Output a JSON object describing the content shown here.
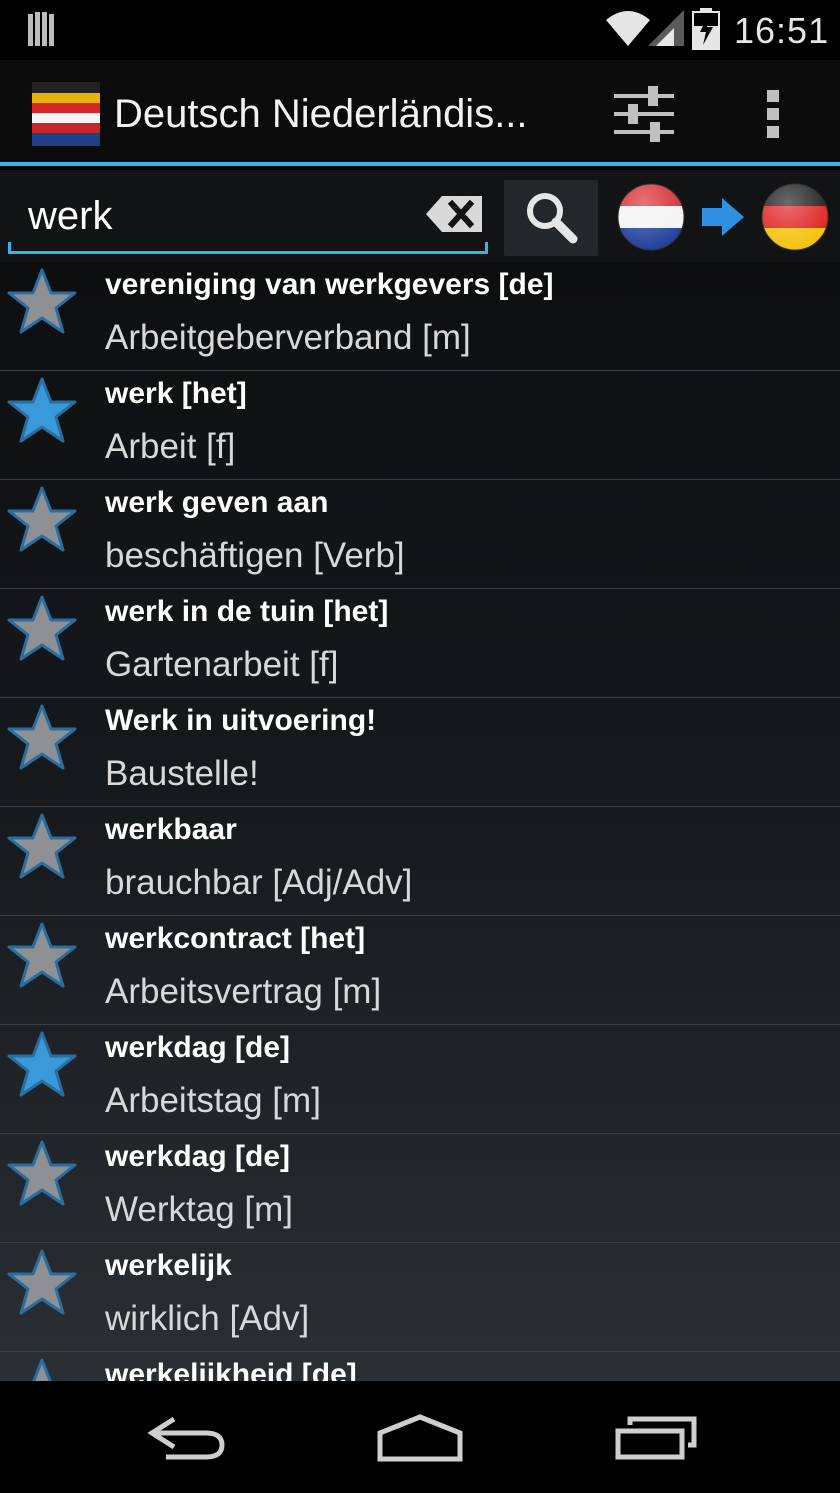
{
  "status_bar": {
    "time": "16:51",
    "icons": [
      "grid-icon",
      "wifi-icon",
      "signal-icon",
      "battery-charging-icon"
    ]
  },
  "action_bar": {
    "title": "Deutsch Niederländis...",
    "icons": [
      "app-flag-icon",
      "settings-sliders-icon",
      "overflow-menu-icon"
    ]
  },
  "search": {
    "value": "werk",
    "icons": [
      "clear-icon",
      "search-icon",
      "dutch-flag-icon",
      "arrow-right-icon",
      "german-flag-icon"
    ]
  },
  "colors": {
    "accent": "#33b5e5",
    "star_favorite": "#3a9ad9",
    "star_default": "#8e9094"
  },
  "results": [
    {
      "source": "vereniging van werkgevers [de]",
      "target": "Arbeitgeberverband [m]",
      "favorite": false
    },
    {
      "source": "werk [het]",
      "target": "Arbeit [f]",
      "favorite": true
    },
    {
      "source": "werk geven aan",
      "target": "beschäftigen [Verb]",
      "favorite": false
    },
    {
      "source": "werk in de tuin [het]",
      "target": "Gartenarbeit [f]",
      "favorite": false
    },
    {
      "source": "Werk in uitvoering!",
      "target": "Baustelle!",
      "favorite": false
    },
    {
      "source": "werkbaar",
      "target": "brauchbar [Adj/Adv]",
      "favorite": false
    },
    {
      "source": "werkcontract [het]",
      "target": "Arbeitsvertrag [m]",
      "favorite": false
    },
    {
      "source": "werkdag [de]",
      "target": "Arbeitstag [m]",
      "favorite": true
    },
    {
      "source": "werkdag [de]",
      "target": "Werktag [m]",
      "favorite": false
    },
    {
      "source": "werkelijk",
      "target": "wirklich [Adv]",
      "favorite": false
    },
    {
      "source": "werkelijkheid [de]",
      "target": "",
      "favorite": false
    }
  ],
  "nav_bar": {
    "icons": [
      "back-icon",
      "home-icon",
      "recents-icon"
    ]
  }
}
